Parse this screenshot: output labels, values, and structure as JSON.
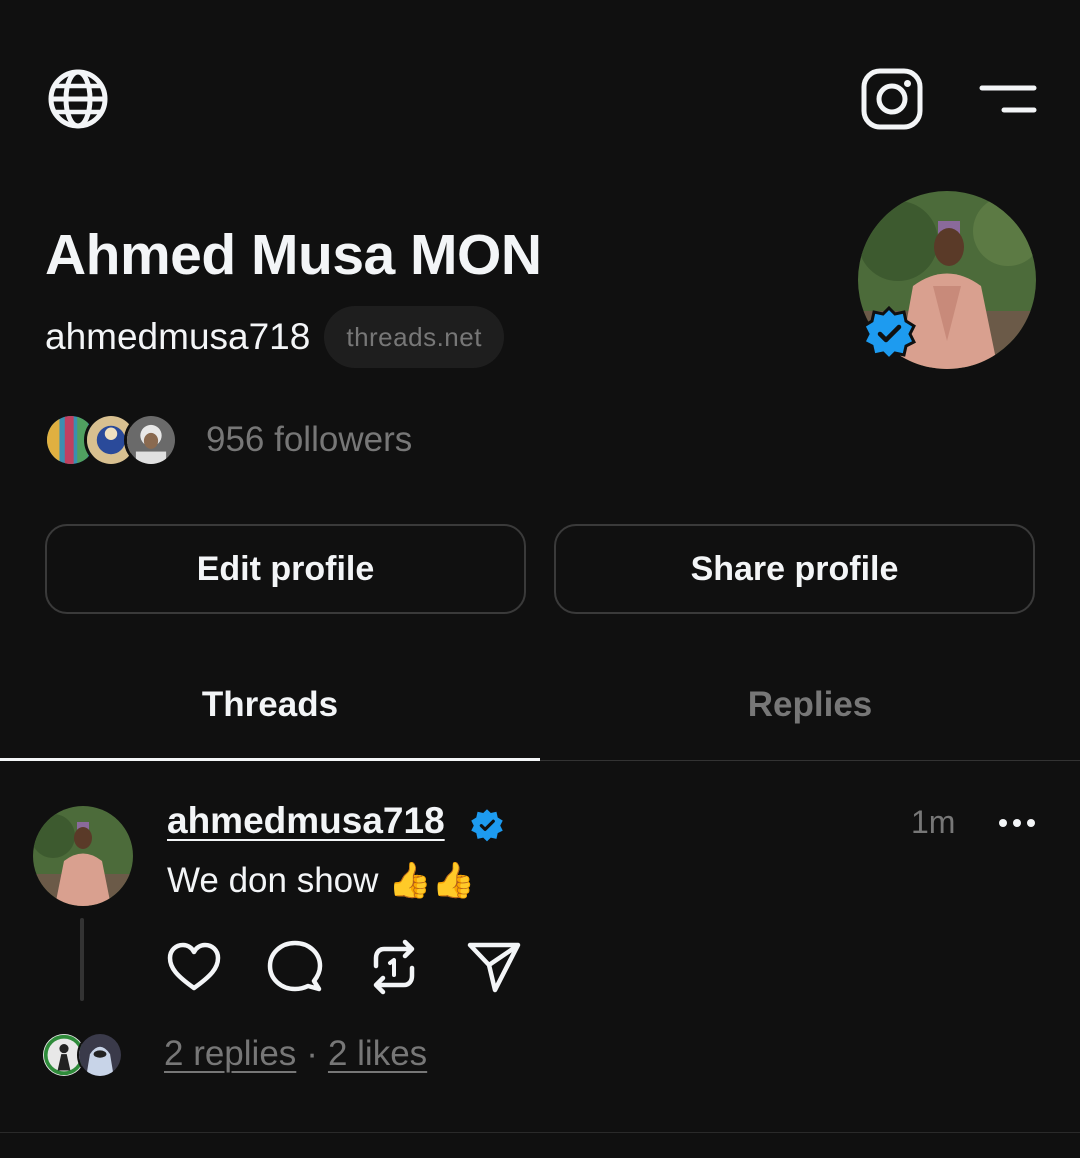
{
  "header": {
    "globe_icon": "globe-icon",
    "instagram_icon": "instagram-icon",
    "menu_icon": "menu-icon"
  },
  "profile": {
    "display_name": "Ahmed Musa MON",
    "username": "ahmedmusa718",
    "domain_badge": "threads.net",
    "followers_label": "956 followers",
    "verified_color": "#1d9bf0"
  },
  "buttons": {
    "edit": "Edit profile",
    "share": "Share profile"
  },
  "tabs": [
    {
      "label": "Threads",
      "active": true
    },
    {
      "label": "Replies",
      "active": false
    }
  ],
  "post": {
    "username": "ahmedmusa718",
    "time": "1m",
    "text": "We don show 👍👍",
    "replies_label": "2 replies",
    "separator": "·",
    "likes_label": "2 likes"
  }
}
